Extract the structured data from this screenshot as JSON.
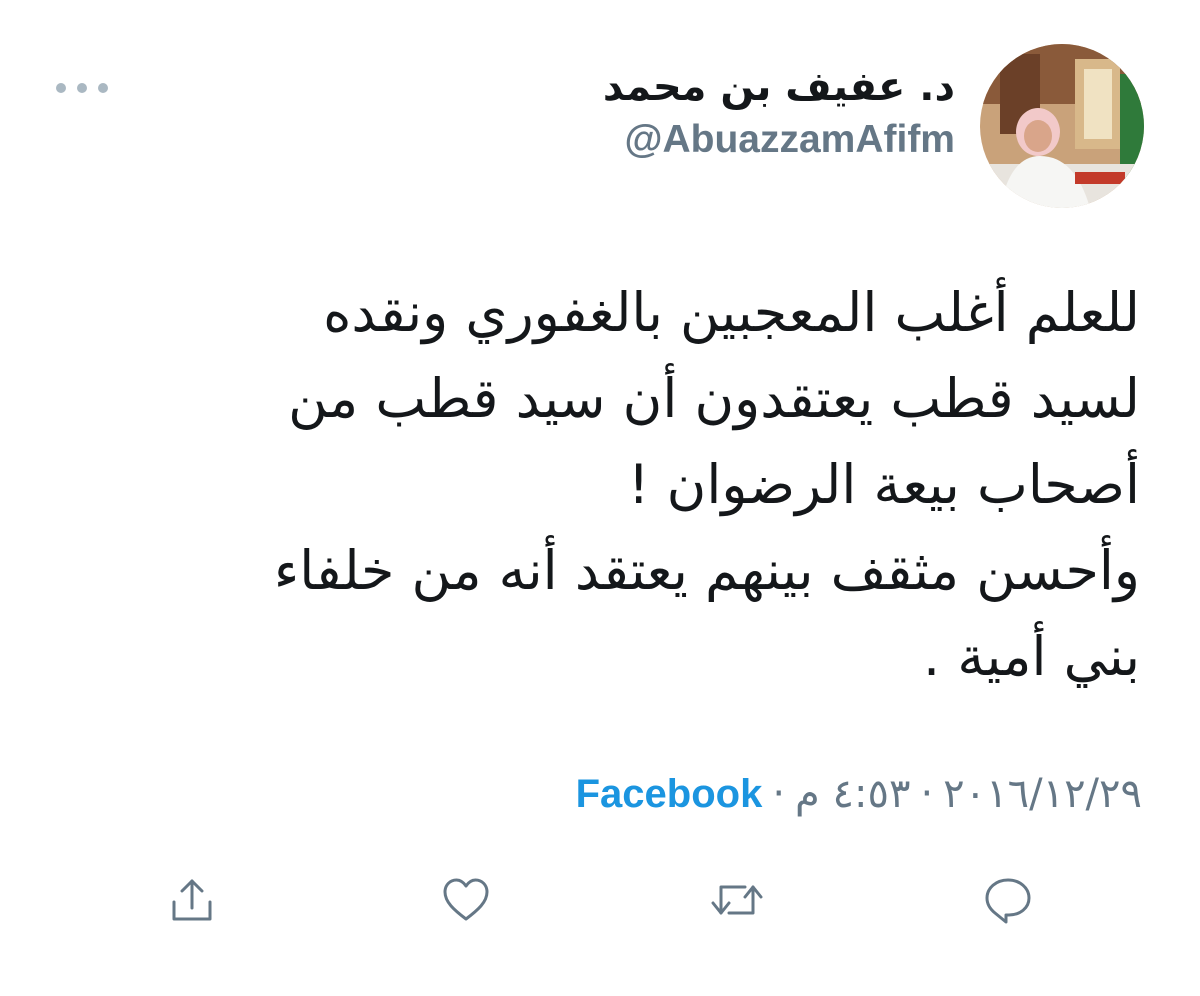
{
  "author": {
    "display_name": "د. عفيف بن محمد",
    "handle": "@AbuazzamAfifm"
  },
  "tweet": {
    "lines": [
      "للعلم أغلب المعجبين بالغفوري ونقده",
      "لسيد قطب يعتقدون أن سيد قطب من",
      "أصحاب بيعة الرضوان  !",
      "وأحسن مثقف بينهم يعتقد أنه من خلفاء",
      "بني أمية ."
    ]
  },
  "meta": {
    "date": "٢٠١٦/١٢/٢٩",
    "separator": "·",
    "time": "٤:٥٣ م",
    "source": "Facebook"
  },
  "actions": {
    "icons": [
      "reply-icon",
      "retweet-icon",
      "like-icon",
      "share-icon"
    ]
  },
  "colors": {
    "text": "#14171a",
    "secondary": "#657786",
    "link": "#1b95e0",
    "icon": "#657786"
  }
}
